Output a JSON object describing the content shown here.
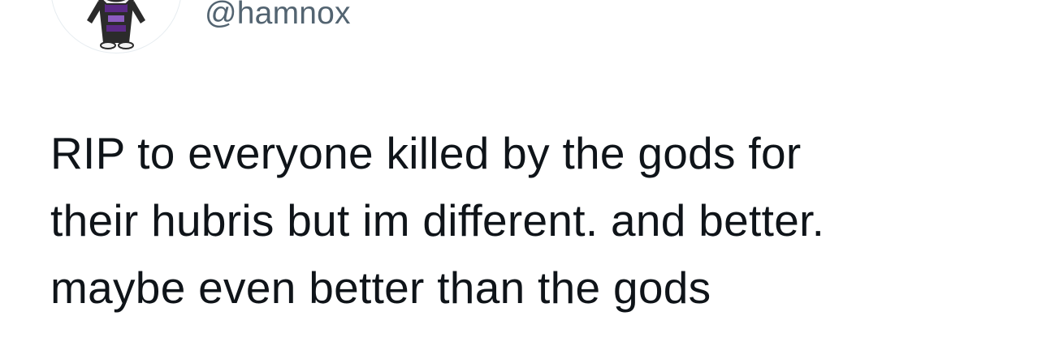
{
  "author": {
    "handle": "@hamnox",
    "avatar_icon": "character-avatar-icon",
    "avatar_colors": {
      "outline": "#2b2b2b",
      "accent": "#5b2a86",
      "skin": "#f2f2f2"
    }
  },
  "tweet": {
    "lines": [
      "RIP to everyone killed by the gods for",
      "their hubris but im different. and better.",
      "maybe even better than the gods"
    ]
  },
  "colors": {
    "text_primary": "#0f1419",
    "text_secondary": "#536471",
    "background": "#ffffff"
  }
}
